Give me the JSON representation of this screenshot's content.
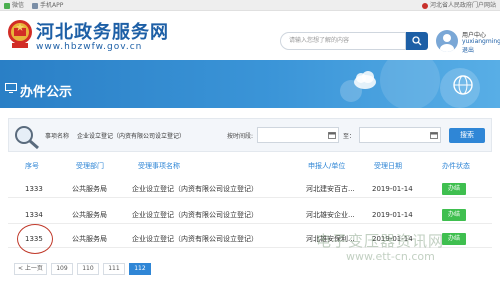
{
  "topbar": {
    "weixin": "微信",
    "mobile_app": "手机APP",
    "portal_link": "河北省人民政府门户网站"
  },
  "header": {
    "site_title": "河北政务服务网",
    "site_url": "www.hbzwfw.gov.cn",
    "search_placeholder": "请输入您想了解的内容",
    "user_center": "用户中心",
    "username": "yuxiangming",
    "logout": "退出"
  },
  "banner": {
    "title": "办件公示"
  },
  "filter": {
    "item_name_label": "事项名称",
    "item_name_value": "企业设立登记（内资有限公司设立登记）",
    "time_label": "按时间段:",
    "to_label": "至：",
    "search_button": "搜索"
  },
  "table": {
    "headers": [
      "序号",
      "受理部门",
      "受理事项名称",
      "申报人/单位",
      "受理日期",
      "办件状态"
    ],
    "rows": [
      {
        "no": "1333",
        "dept": "公共服务局",
        "item": "企业设立登记（内资有限公司设立登记）",
        "applicant": "河北建安百古...",
        "date": "2019-01-14",
        "status": "办结"
      },
      {
        "no": "1334",
        "dept": "公共服务局",
        "item": "企业设立登记（内资有限公司设立登记）",
        "applicant": "河北雄安企业...",
        "date": "2019-01-14",
        "status": "办结"
      },
      {
        "no": "1335",
        "dept": "公共服务局",
        "item": "企业设立登记（内资有限公司设立登记）",
        "applicant": "河北雄安保利...",
        "date": "2019-01-14",
        "status": "办结"
      }
    ]
  },
  "pager": {
    "prev": "< 上一页",
    "pages": [
      "109",
      "110",
      "111",
      "112"
    ],
    "active_page": "112"
  },
  "watermark": {
    "line1": "电子变压器资讯网",
    "line2": "www.ett-cn.com"
  },
  "colors": {
    "brand_blue": "#1d5fa6",
    "accent_blue": "#2f86d6",
    "status_green": "#3fbf4f",
    "annotation_red": "#c03a2b"
  }
}
